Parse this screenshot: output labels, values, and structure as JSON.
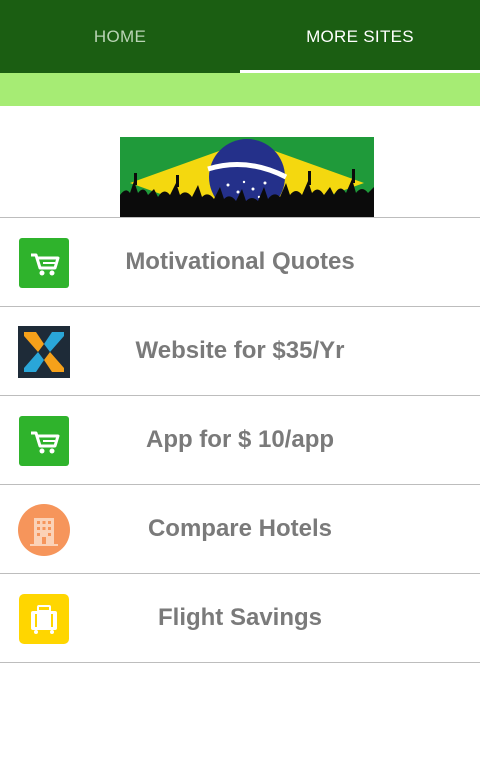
{
  "tabs": [
    {
      "label": "HOME"
    },
    {
      "label": "MORE SITES"
    }
  ],
  "banner": {
    "icon": "brazil-flag-crowd-image"
  },
  "items": [
    {
      "label": "Motivational Quotes",
      "icon": "shopping-cart-icon"
    },
    {
      "label": "Website for $35/Yr",
      "icon": "x-logo-icon"
    },
    {
      "label": "App for $ 10/app",
      "icon": "shopping-cart-icon"
    },
    {
      "label": "Compare Hotels",
      "icon": "hotel-icon"
    },
    {
      "label": "Flight Savings",
      "icon": "luggage-icon"
    }
  ],
  "colors": {
    "tab_bar": "#1b5e12",
    "accent_bar": "#a6ec74",
    "label_text": "#7a7a7a",
    "cart_icon_bg": "#2fb32c",
    "hotel_icon_bg": "#f6955b",
    "luggage_icon_bg": "#ffd600"
  }
}
